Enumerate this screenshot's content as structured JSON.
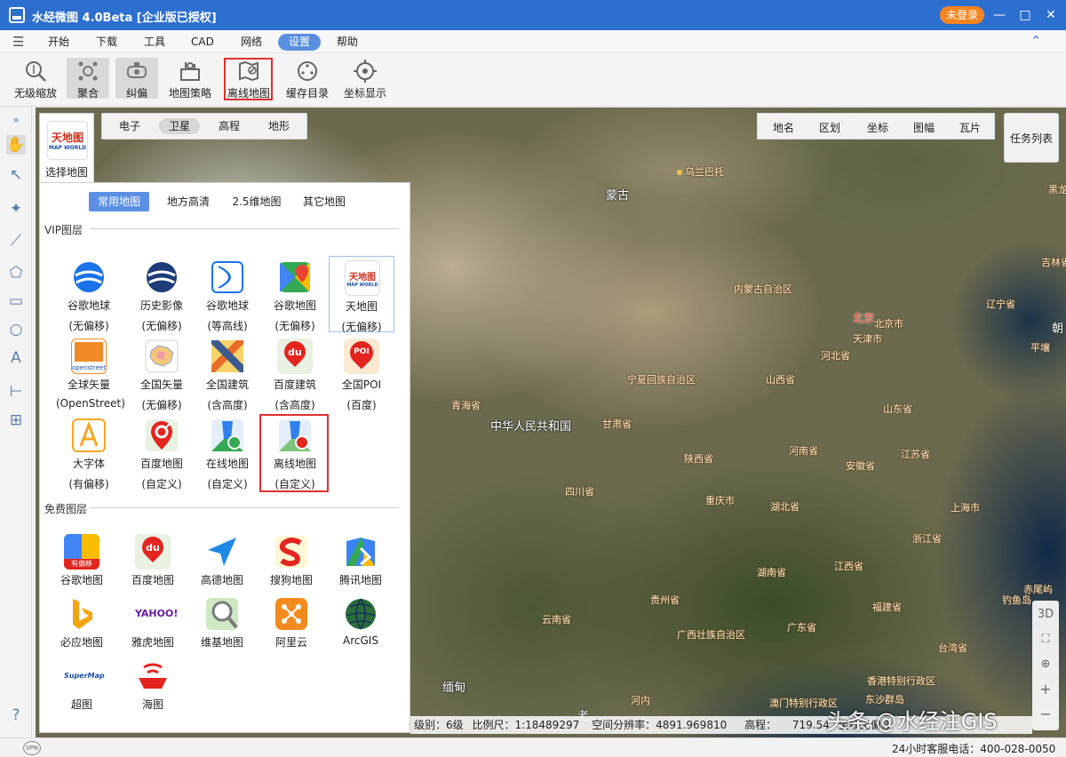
{
  "app": {
    "title": "水经微图 4.0Beta [企业版已授权]",
    "login": "未登录"
  },
  "window": {
    "minimize": "—",
    "maximize": "□",
    "close": "✕"
  },
  "menu": [
    "开始",
    "下载",
    "工具",
    "CAD",
    "网络",
    "设置",
    "帮助"
  ],
  "menu_active": "设置",
  "toolbar": [
    {
      "label": "无级缩放",
      "icon": "zoom-icon"
    },
    {
      "label": "聚合",
      "icon": "cluster-icon"
    },
    {
      "label": "纠偏",
      "icon": "correction-icon"
    },
    {
      "label": "地图策略",
      "icon": "map-strategy-icon"
    },
    {
      "label": "离线地图",
      "icon": "offline-map-icon"
    },
    {
      "label": "缓存目录",
      "icon": "cache-folder-icon"
    },
    {
      "label": "坐标显示",
      "icon": "coordinate-icon"
    }
  ],
  "map_types": [
    "电子",
    "卫星",
    "高程",
    "地形"
  ],
  "map_type_active": "卫星",
  "right_tools": [
    "地名",
    "区划",
    "坐标",
    "图幅",
    "瓦片"
  ],
  "task_list": "任务列表",
  "selector": {
    "logo_line1": "天地图",
    "logo_line2": "MAP WORLD",
    "label": "选择地图"
  },
  "panel": {
    "tabs": [
      "常用地图",
      "地方高清",
      "2.5维地图",
      "其它地图"
    ],
    "vip_title": "VIP图层",
    "vip": [
      {
        "name": "谷歌地球",
        "sub": "(无偏移)"
      },
      {
        "name": "历史影像",
        "sub": "(无偏移)"
      },
      {
        "name": "谷歌地球",
        "sub": "(等高线)"
      },
      {
        "name": "谷歌地图",
        "sub": "(无偏移)"
      },
      {
        "name": "天地图",
        "sub": "(无偏移)"
      },
      {
        "name": "全球矢量",
        "sub": "(OpenStreet)"
      },
      {
        "name": "全国矢量",
        "sub": "(无偏移)"
      },
      {
        "name": "全国建筑",
        "sub": "(含高度)"
      },
      {
        "name": "百度建筑",
        "sub": "(含高度)"
      },
      {
        "name": "全国POI",
        "sub": "(百度)"
      },
      {
        "name": "大字体",
        "sub": "(有偏移)"
      },
      {
        "name": "百度地图",
        "sub": "(自定义)"
      },
      {
        "name": "在线地图",
        "sub": "(自定义)"
      },
      {
        "name": "离线地图",
        "sub": "(自定义)"
      }
    ],
    "free_title": "免费图层",
    "free": [
      "谷歌地图",
      "百度地图",
      "高德地图",
      "搜狗地图",
      "腾讯地图",
      "必应地图",
      "雅虎地图",
      "维基地图",
      "阿里云",
      "ArcGIS",
      "超图",
      "海图"
    ],
    "icon_texts": {
      "openstreet": "openstreet",
      "du": "du",
      "poi": "POI",
      "youpianyi": "有偏移",
      "yahoo": "YAHOO!",
      "supermap": "SuperMap"
    }
  },
  "map_labels": {
    "mongolia": "蒙古",
    "wulanbatuo": "乌兰巴托",
    "neimenggu": "内蒙古自治区",
    "beijing_cap": "北京",
    "beijing": "北京市",
    "tianjin": "天津市",
    "hebei": "河北省",
    "liaoning": "辽宁省",
    "jilin": "吉林省",
    "heilong": "黑龙",
    "pingrang": "平壤",
    "chaoxian": "朝",
    "ningxia": "宁夏回族自治区",
    "shanxi": "山西省",
    "shandong": "山东省",
    "qinghai": "青海省",
    "china": "中华人民共和国",
    "gansu": "甘肃省",
    "henan": "河南省",
    "jiangsu": "江苏省",
    "shaanxi": "陕西省",
    "anhui": "安徽省",
    "sichuan": "四川省",
    "chongqing": "重庆市",
    "hubei": "湖北省",
    "shanghai": "上海市",
    "zhejiang": "浙江省",
    "hunan": "湖南省",
    "jiangxi": "江西省",
    "guizhou": "贵州省",
    "fujian": "福建省",
    "chiwei": "赤尾屿",
    "diaoyu": "钓鱼岛",
    "taiwan": "台湾省",
    "yunnan": "云南省",
    "guangxi": "广西壮族自治区",
    "guangdong": "广东省",
    "xianggang": "香港特别行政区",
    "aomen": "澳门特别行政区",
    "dongsha": "东沙群岛",
    "miandian": "缅甸",
    "henei": "河内",
    "lao": "老"
  },
  "status": {
    "level": "级别：6级",
    "scale": "比例尺：1:18489297",
    "resolution": "空间分辨率：4891.969810",
    "elevation": "高程：",
    "elevation_val": "719.54",
    "coord": "坐标无偏移"
  },
  "watermark": "头条 @水经注GIS",
  "map_ctrls": [
    "3D",
    "⛶",
    "⊕",
    "+",
    "−"
  ],
  "hotline": "24小时客服电话：400-028-0050",
  "vpn": "VPN"
}
